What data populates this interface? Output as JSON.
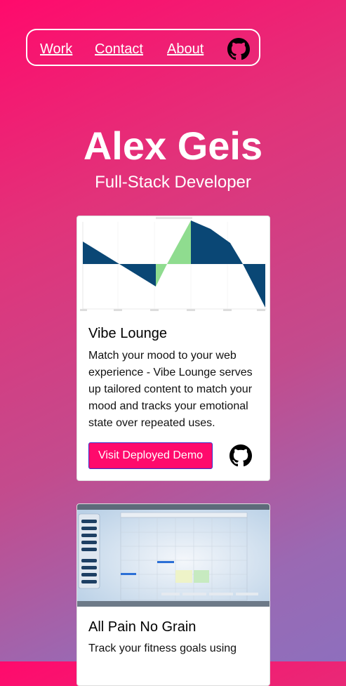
{
  "nav": {
    "links": [
      "Work",
      "Contact",
      "About"
    ],
    "github_icon": "github-icon"
  },
  "hero": {
    "name": "Alex Geis",
    "subtitle": "Full-Stack Developer"
  },
  "projects": [
    {
      "title": "Vibe Lounge",
      "description": "Match your mood to your web experience - Vibe Lounge serves up tailored content to match your mood and tracks your emotional state over repeated uses.",
      "button_label": "Visit Deployed Demo",
      "thumbnail": "mood-chart-screenshot",
      "github_icon": "github-icon"
    },
    {
      "title": "All Pain No Grain",
      "description": "Track your fitness goals using",
      "thumbnail": "calendar-app-screenshot"
    }
  ],
  "colors": {
    "accent": "#ff0a6c",
    "chart_blue": "#0a4775",
    "chart_green": "#8fdc8f"
  }
}
